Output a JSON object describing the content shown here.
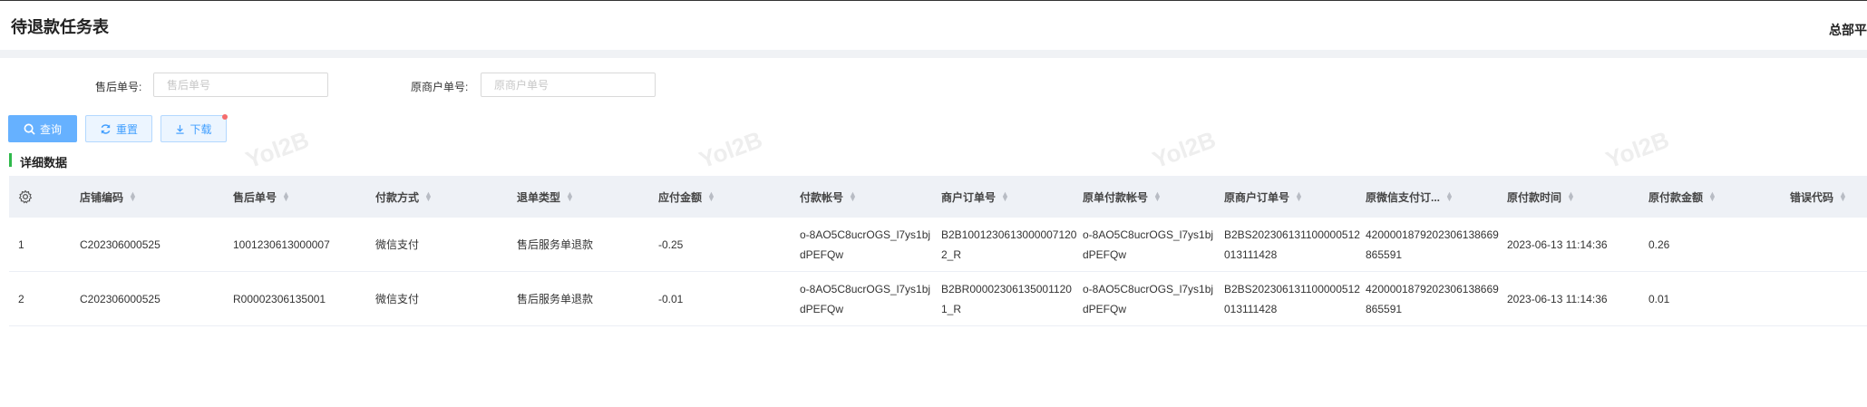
{
  "header": {
    "title": "待退款任务表",
    "org": "总部平"
  },
  "filters": {
    "after_sale_label": "售后单号:",
    "after_sale_placeholder": "售后单号",
    "orig_merchant_label": "原商户单号:",
    "orig_merchant_placeholder": "原商户单号"
  },
  "buttons": {
    "query": "查询",
    "reset": "重置",
    "download": "下载"
  },
  "section": {
    "title": "详细数据"
  },
  "table": {
    "columns": [
      "店铺编码",
      "售后单号",
      "付款方式",
      "退单类型",
      "应付金额",
      "付款帐号",
      "商户订单号",
      "原单付款帐号",
      "原商户订单号",
      "原微信支付订...",
      "原付款时间",
      "原付款金额",
      "错误代码"
    ],
    "rows": [
      [
        "1",
        "C202306000525",
        "1001230613000007",
        "微信支付",
        "售后服务单退款",
        "-0.25",
        "o-8AO5C8ucrOGS_l7ys1bjdPEFQw",
        "B2B10012306130000071202_R",
        "o-8AO5C8ucrOGS_l7ys1bjdPEFQw",
        "B2BS202306131100000512013111428",
        "420000187920230613866986​5591",
        "2023-06-13 11:14:36",
        "0.26",
        ""
      ],
      [
        "2",
        "C202306000525",
        "R00002306135001",
        "微信支付",
        "售后服务单退款",
        "-0.01",
        "o-8AO5C8ucrOGS_l7ys1bjdPEFQw",
        "B2BR000023061350011201_R",
        "o-8AO5C8ucrOGS_l7ys1bjdPEFQw",
        "B2BS202306131100000512013111428",
        "4200001879202306138669865591",
        "2023-06-13 11:14:36",
        "0.01",
        ""
      ]
    ]
  },
  "watermark": "Yol2B",
  "colors": {
    "primary": "#66b1ff",
    "accent_bar": "#2fb94b",
    "header_bg": "#eef1f6"
  }
}
